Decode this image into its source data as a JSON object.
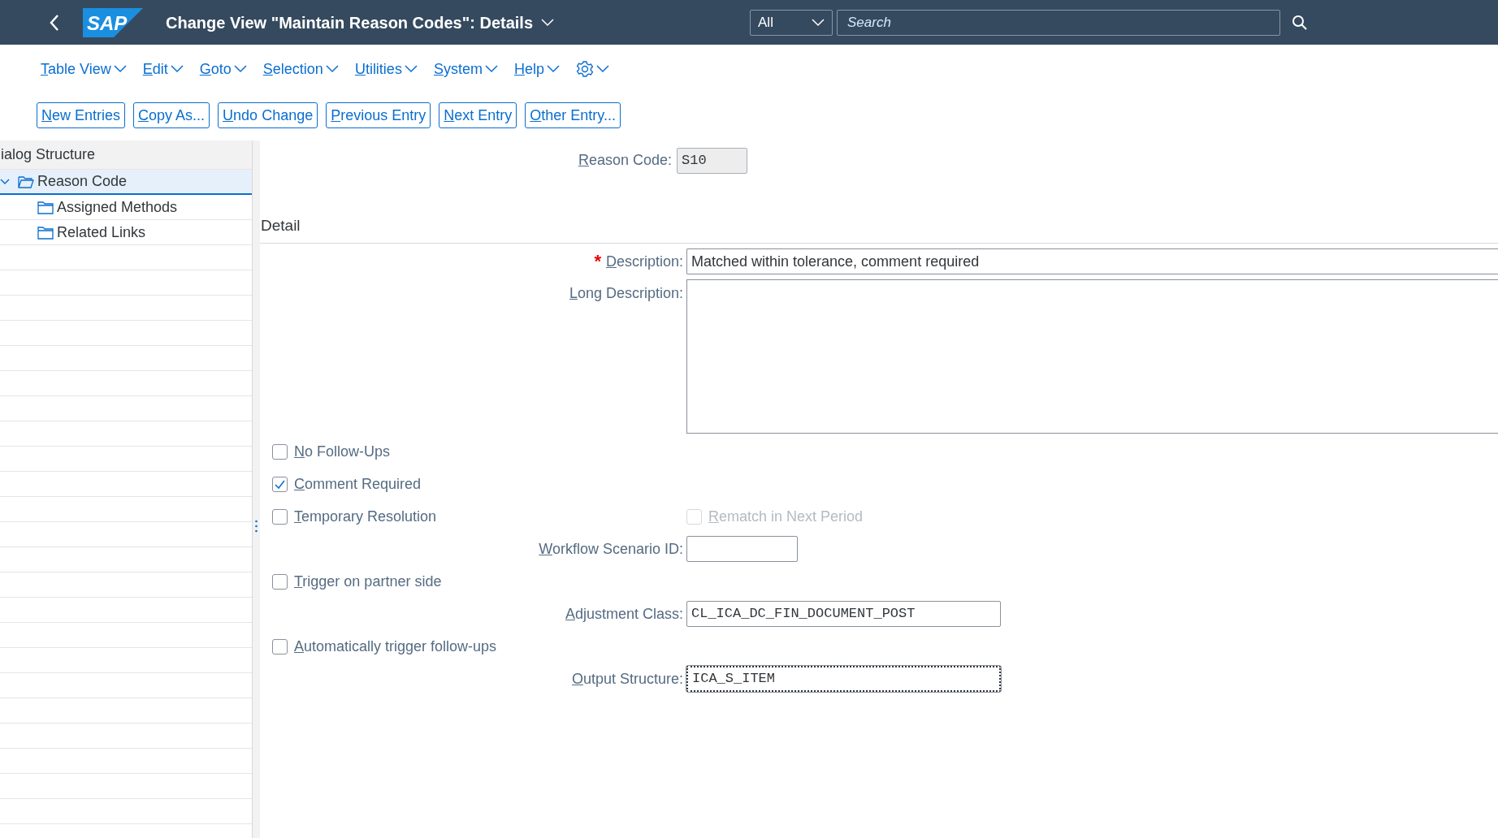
{
  "shell": {
    "title": "Change View \"Maintain Reason Codes\": Details",
    "search_scope": "All",
    "search_placeholder": "Search",
    "logo_text": "SAP"
  },
  "menu": [
    "Table View",
    "Edit",
    "Goto",
    "Selection",
    "Utilities",
    "System",
    "Help"
  ],
  "toolbar": [
    "New Entries",
    "Copy As...",
    "Undo Change",
    "Previous Entry",
    "Next Entry",
    "Other Entry..."
  ],
  "dialog_structure": {
    "title": "ialog Structure",
    "items": [
      {
        "label": "Reason Code",
        "expanded": true,
        "selected": true,
        "children": [
          {
            "label": "Assigned Methods",
            "selected": false
          },
          {
            "label": "Related Links",
            "selected": false
          }
        ]
      }
    ]
  },
  "reason_code": {
    "label": "Reason Code:",
    "value": "S10",
    "readonly": true
  },
  "section_title": "Detail",
  "rows": [
    {
      "kind": "text",
      "label": "Description:",
      "value": "Matched within tolerance, comment required",
      "required": true,
      "required_mark": "*"
    },
    {
      "kind": "textarea",
      "label": "Long Description:"
    },
    {
      "kind": "checkbox",
      "label": "No Follow-Ups",
      "checked": false,
      "disabled": false
    },
    {
      "kind": "checkbox",
      "label": "Comment Required",
      "checked": true,
      "disabled": false
    },
    {
      "kind": "checkbox",
      "label": "Temporary Resolution",
      "checked": false,
      "disabled": false,
      "beside": {
        "label": "Rematch in Next Period",
        "checked": false,
        "disabled": true
      }
    },
    {
      "kind": "code",
      "label": "Workflow Scenario ID:",
      "focused": false
    },
    {
      "kind": "checkbox",
      "label": "Trigger on partner side",
      "checked": false,
      "disabled": false
    },
    {
      "kind": "code",
      "label": "Adjustment Class:",
      "value": "CL_ICA_DC_FIN_DOCUMENT_POST",
      "focused": false
    },
    {
      "kind": "checkbox",
      "label": "Automatically trigger follow-ups",
      "checked": false,
      "disabled": false
    },
    {
      "kind": "code",
      "label": "Output Structure:",
      "value": "ICA_S_ITEM",
      "focused": true
    }
  ]
}
